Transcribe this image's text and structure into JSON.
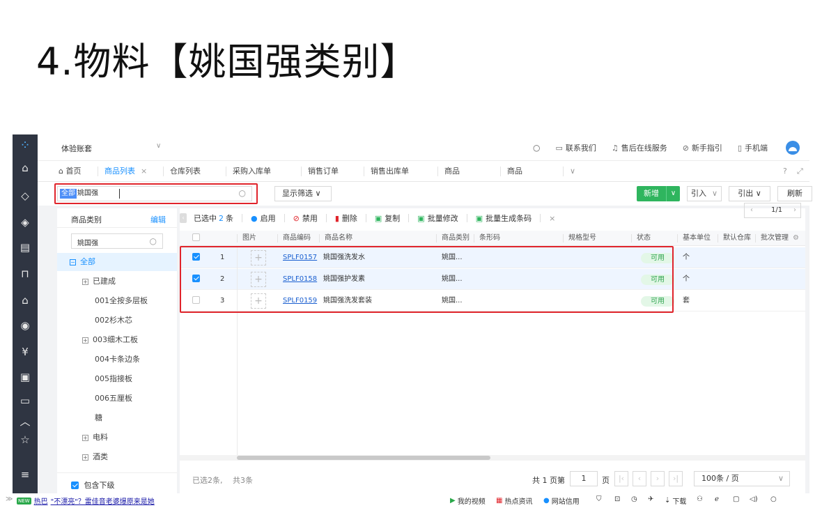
{
  "slide_title": "4.物料【姚国强类别】",
  "topbar": {
    "account": "体验账套",
    "account_arrow": "∨",
    "search_icon": "search-icon",
    "contact": "联系我们",
    "service": "售后在线服务",
    "guide": "新手指引",
    "mobile": "手机端"
  },
  "tabs": [
    {
      "label": "首页"
    },
    {
      "label": "商品列表",
      "close": "×"
    },
    {
      "label": "仓库列表"
    },
    {
      "label": "采购入库单"
    },
    {
      "label": "销售订单"
    },
    {
      "label": "销售出库单"
    },
    {
      "label": "商品"
    },
    {
      "label": "商品"
    }
  ],
  "toolbar": {
    "search_tag": "全部",
    "search_value": "姚国强",
    "filter_label": "显示筛选 ∨",
    "new_label": "新增",
    "import_label": "引入",
    "export_label": "引出 ∨",
    "refresh_label": "刷新"
  },
  "sidebar": {
    "title": "商品类别",
    "edit": "编辑",
    "search_value": "姚国强",
    "tree": [
      {
        "label": "全部",
        "marker": "−",
        "level": 0,
        "selected": true
      },
      {
        "label": "已建成",
        "marker": "+",
        "level": 1
      },
      {
        "label": "001全按多层板",
        "marker": "",
        "level": 2
      },
      {
        "label": "002杉木芯",
        "marker": "",
        "level": 2
      },
      {
        "label": "003细木工板",
        "marker": "+",
        "level": 1
      },
      {
        "label": "004卡条边条",
        "marker": "",
        "level": 2
      },
      {
        "label": "005指接板",
        "marker": "",
        "level": 2
      },
      {
        "label": "006五厘板",
        "marker": "",
        "level": 2
      },
      {
        "label": "糖",
        "marker": "",
        "level": 2
      },
      {
        "label": "电料",
        "marker": "+",
        "level": 1
      },
      {
        "label": "酒类",
        "marker": "+",
        "level": 1
      }
    ],
    "include_sub": "包含下级"
  },
  "actions": {
    "selected_prefix": "已选中",
    "selected_count": "2",
    "selected_suffix": "条",
    "enable": "启用",
    "disable": "禁用",
    "delete": "删除",
    "copy": "复制",
    "batch_edit": "批量修改",
    "batch_barcode": "批量生成条码",
    "close": "×",
    "page_info": "1/1"
  },
  "table": {
    "headers": [
      "图片",
      "商品编码",
      "商品名称",
      "商品类别",
      "条形码",
      "规格型号",
      "状态",
      "基本单位",
      "默认仓库",
      "批次管理"
    ],
    "rows": [
      {
        "checked": true,
        "index": "1",
        "code": "SPLF0157",
        "name": "姚国强洗发水",
        "category": "姚国...",
        "status": "可用",
        "unit": "个"
      },
      {
        "checked": true,
        "index": "2",
        "code": "SPLF0158",
        "name": "姚国强护发素",
        "category": "姚国...",
        "status": "可用",
        "unit": "个"
      },
      {
        "checked": false,
        "index": "3",
        "code": "SPLF0159",
        "name": "姚国强洗发套装",
        "category": "姚国...",
        "status": "可用",
        "unit": "套"
      }
    ]
  },
  "footer": {
    "selected": "已选2条,",
    "total": "共3条",
    "pages_prefix": "共 1 页第",
    "page_value": "1",
    "page_suffix": "页",
    "per_page": "100条 / 页"
  },
  "statusbar": {
    "badge": "NEW",
    "hot_prefix": "热巴",
    "news": "\"不漂亮\"？雷佳音老婆爆原来是她",
    "video": "我的视频",
    "hot_news": "热点资讯",
    "credit": "网站信用",
    "download": "下载"
  },
  "colors": {
    "accent": "#1890ff",
    "success": "#2fb55e",
    "highlight": "#e0242b",
    "sidebar_dark": "#2f3542"
  }
}
